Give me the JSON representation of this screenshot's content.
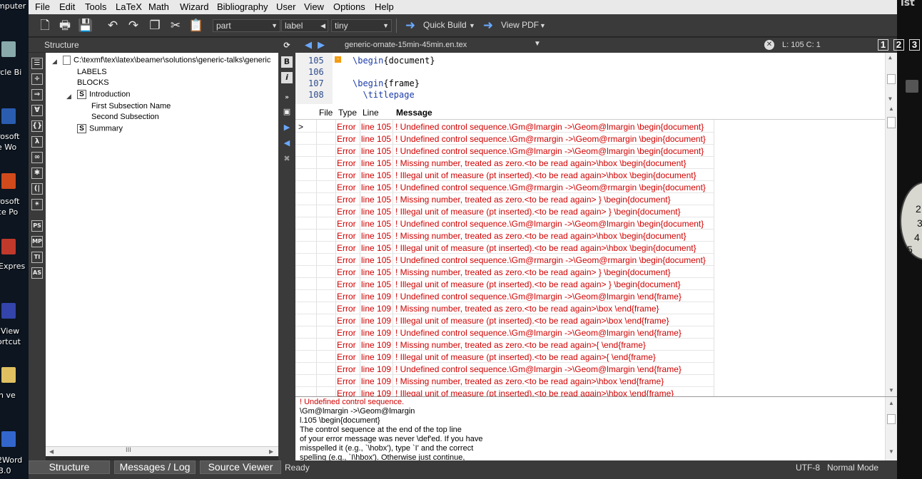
{
  "desktop": {
    "left_labels": [
      "mputer",
      "rcle Bi",
      "rosoft",
      "e Wo",
      "rosoft",
      "ce Po",
      "Expres",
      "jView",
      "ortcut",
      "h ve",
      "2Word",
      "3.0"
    ],
    "right_text": "ist",
    "clock_numbers": [
      "2",
      "3",
      "4",
      "5"
    ]
  },
  "menu": [
    "File",
    "Edit",
    "Tools",
    "LaTeX",
    "Math",
    "Wizard",
    "Bibliography",
    "User",
    "View",
    "Options",
    "Help"
  ],
  "toolbar": {
    "combo_part": "part",
    "combo_label": "label",
    "combo_size": "tiny",
    "quick_build": "Quick Build",
    "view_pdf": "View PDF"
  },
  "structure": {
    "header": "Structure",
    "root_path": "C:\\texmf\\tex\\latex\\beamer\\solutions\\generic-talks\\generic",
    "labels": "LABELS",
    "blocks": "BLOCKS",
    "section1": "Introduction",
    "subsection1": "First Subsection Name",
    "subsection2": "Second Subsection",
    "section2": "Summary",
    "section_glyph": "S",
    "scroll_grip": "III"
  },
  "editor": {
    "filename": "generic-ornate-15min-45min.en.tex",
    "cursor_pos": "L: 105 C: 1",
    "view_buttons": [
      "1",
      "2",
      "3"
    ],
    "fold_glyph": "-",
    "lines": [
      {
        "num": "105",
        "cmd": "\\begin",
        "arg": "{document}"
      },
      {
        "num": "106",
        "cmd": "",
        "arg": ""
      },
      {
        "num": "107",
        "cmd": "\\begin",
        "arg": "{frame}"
      },
      {
        "num": "108",
        "cmd": "  \\titlepage",
        "arg": ""
      }
    ]
  },
  "messages": {
    "columns": [
      "File",
      "Type",
      "Line",
      "Message"
    ],
    "current_marker": ">",
    "rows": [
      {
        "type": "Error",
        "line": "line 105",
        "msg": "! Undefined control sequence.\\Gm@lmargin ->\\Geom@lmargin \\begin{document}"
      },
      {
        "type": "Error",
        "line": "line 105",
        "msg": "! Undefined control sequence.\\Gm@rmargin ->\\Geom@rmargin \\begin{document}"
      },
      {
        "type": "Error",
        "line": "line 105",
        "msg": "! Undefined control sequence.\\Gm@lmargin ->\\Geom@lmargin \\begin{document}"
      },
      {
        "type": "Error",
        "line": "line 105",
        "msg": "! Missing number, treated as zero.<to be read again>\\hbox \\begin{document}"
      },
      {
        "type": "Error",
        "line": "line 105",
        "msg": "! Illegal unit of measure (pt inserted).<to be read again>\\hbox \\begin{document}"
      },
      {
        "type": "Error",
        "line": "line 105",
        "msg": "! Undefined control sequence.\\Gm@rmargin ->\\Geom@rmargin \\begin{document}"
      },
      {
        "type": "Error",
        "line": "line 105",
        "msg": "! Missing number, treated as zero.<to be read again> } \\begin{document}"
      },
      {
        "type": "Error",
        "line": "line 105",
        "msg": "! Illegal unit of measure (pt inserted).<to be read again> } \\begin{document}"
      },
      {
        "type": "Error",
        "line": "line 105",
        "msg": "! Undefined control sequence.\\Gm@lmargin ->\\Geom@lmargin \\begin{document}"
      },
      {
        "type": "Error",
        "line": "line 105",
        "msg": "! Missing number, treated as zero.<to be read again>\\hbox \\begin{document}"
      },
      {
        "type": "Error",
        "line": "line 105",
        "msg": "! Illegal unit of measure (pt inserted).<to be read again>\\hbox \\begin{document}"
      },
      {
        "type": "Error",
        "line": "line 105",
        "msg": "! Undefined control sequence.\\Gm@rmargin ->\\Geom@rmargin \\begin{document}"
      },
      {
        "type": "Error",
        "line": "line 105",
        "msg": "! Missing number, treated as zero.<to be read again> } \\begin{document}"
      },
      {
        "type": "Error",
        "line": "line 105",
        "msg": "! Illegal unit of measure (pt inserted).<to be read again> } \\begin{document}"
      },
      {
        "type": "Error",
        "line": "line 109",
        "msg": "! Undefined control sequence.\\Gm@lmargin ->\\Geom@lmargin \\end{frame}"
      },
      {
        "type": "Error",
        "line": "line 109",
        "msg": "! Missing number, treated as zero.<to be read again>\\box \\end{frame}"
      },
      {
        "type": "Error",
        "line": "line 109",
        "msg": "! Illegal unit of measure (pt inserted).<to be read again>\\box \\end{frame}"
      },
      {
        "type": "Error",
        "line": "line 109",
        "msg": "! Undefined control sequence.\\Gm@lmargin ->\\Geom@lmargin \\end{frame}"
      },
      {
        "type": "Error",
        "line": "line 109",
        "msg": "! Missing number, treated as zero.<to be read again>{ \\end{frame}"
      },
      {
        "type": "Error",
        "line": "line 109",
        "msg": "! Illegal unit of measure (pt inserted).<to be read again>{ \\end{frame}"
      },
      {
        "type": "Error",
        "line": "line 109",
        "msg": "! Undefined control sequence.\\Gm@lmargin ->\\Geom@lmargin \\end{frame}"
      },
      {
        "type": "Error",
        "line": "line 109",
        "msg": "! Missing number, treated as zero.<to be read again>\\hbox \\end{frame}"
      },
      {
        "type": "Error",
        "line": "line 109",
        "msg": "! Illegal unit of measure (pt inserted).<to be read again>\\hbox \\end{frame}"
      }
    ]
  },
  "detail": {
    "lines": [
      "! Undefined control sequence.",
      "\\Gm@lmargin ->\\Geom@lmargin",
      "l.105 \\begin{document}",
      "The control sequence at the end of the top line",
      "of your error message was never \\def'ed. If you have",
      "misspelled it (e.g., `\\hobx'), type `I' and the correct",
      "spelling (e.g., `I\\hbox'). Otherwise just continue,"
    ]
  },
  "status": {
    "tab_structure": "Structure",
    "tab_messages": "Messages / Log",
    "tab_source": "Source Viewer",
    "ready": "Ready",
    "encoding": "UTF-8",
    "mode": "Normal Mode"
  },
  "colors": {
    "error_red": "#d00000",
    "keyword_blue": "#1a3aa8",
    "panel_dark": "#3a3a3a"
  }
}
